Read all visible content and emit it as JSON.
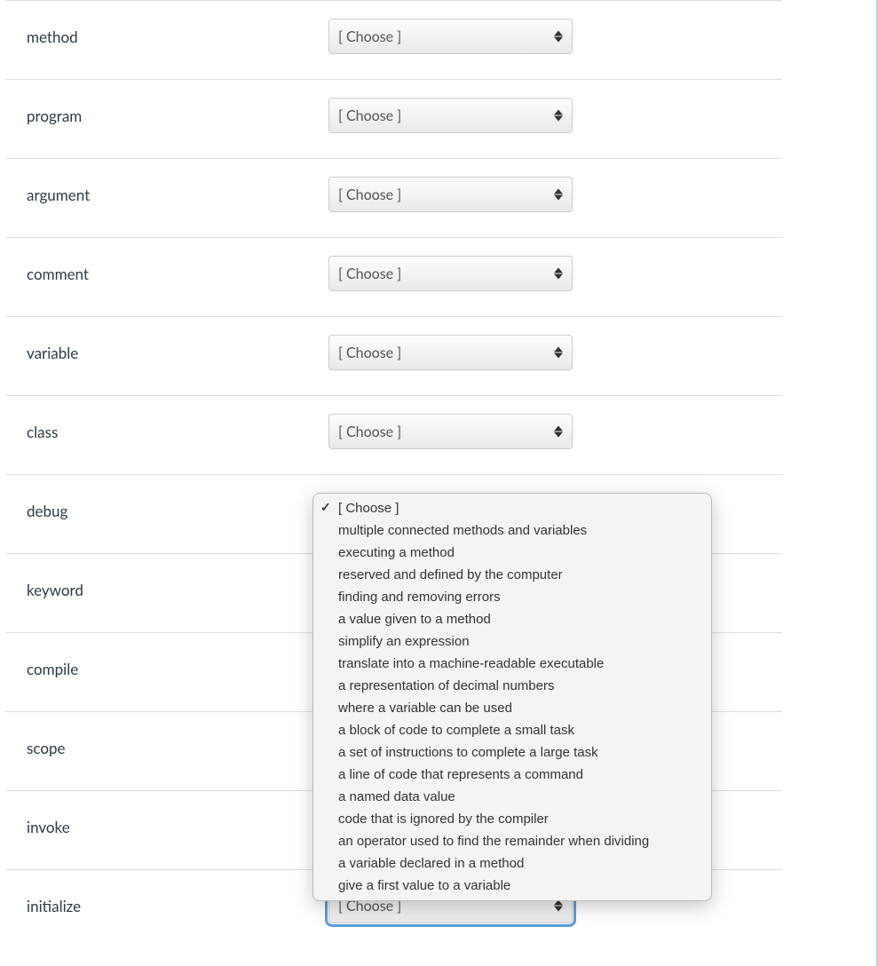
{
  "placeholder": "[ Choose ]",
  "rows": [
    {
      "label": "method"
    },
    {
      "label": "program"
    },
    {
      "label": "argument"
    },
    {
      "label": "comment"
    },
    {
      "label": "variable"
    },
    {
      "label": "class"
    },
    {
      "label": "debug"
    },
    {
      "label": "keyword"
    },
    {
      "label": "compile"
    },
    {
      "label": "scope"
    },
    {
      "label": "invoke"
    },
    {
      "label": "initialize"
    }
  ],
  "dropdown_options": [
    "[ Choose ]",
    "multiple connected methods and variables",
    "executing a method",
    "reserved and defined by the computer",
    "finding and removing errors",
    "a value given to a method",
    "simplify an expression",
    "translate into a machine-readable executable",
    "a representation of decimal numbers",
    "where a variable can be used",
    "a block of code to complete a small task",
    "a set of instructions to complete a large task",
    "a line of code that represents a command",
    "a named data value",
    "code that is ignored by the compiler",
    "an operator used to find the remainder when dividing",
    "a variable declared in a method",
    "give a first value to a variable"
  ],
  "dropdown_selected_index": 0,
  "focused_row_index": 11
}
